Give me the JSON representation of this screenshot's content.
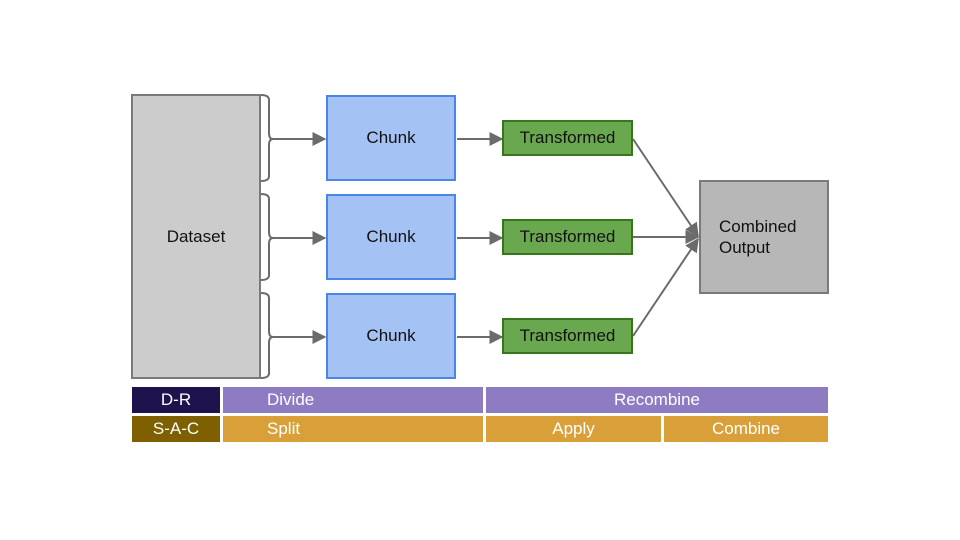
{
  "diagram": {
    "dataset_label": "Dataset",
    "chunks": [
      "Chunk",
      "Chunk",
      "Chunk"
    ],
    "transformed": [
      "Transformed",
      "Transformed",
      "Transformed"
    ],
    "output_label_lines": [
      "Combined",
      "Output"
    ]
  },
  "legend": {
    "row1": {
      "key": "D-R",
      "segments": [
        "Divide",
        "Recombine"
      ]
    },
    "row2": {
      "key": "S-A-C",
      "segments": [
        "Split",
        "Apply",
        "Combine"
      ]
    }
  },
  "colors": {
    "dataset_fill": "#cccccc",
    "chunk_fill": "#a4c2f4",
    "chunk_border": "#4a86e8",
    "transformed_fill": "#6aa84f",
    "transformed_border": "#38761d",
    "output_fill": "#b7b7b7",
    "dr_key": "#20124d",
    "dr_band": "#8e7cc3",
    "sac_key": "#7f6000",
    "sac_band": "#d9a03a",
    "arrow": "#6b6b6b"
  }
}
